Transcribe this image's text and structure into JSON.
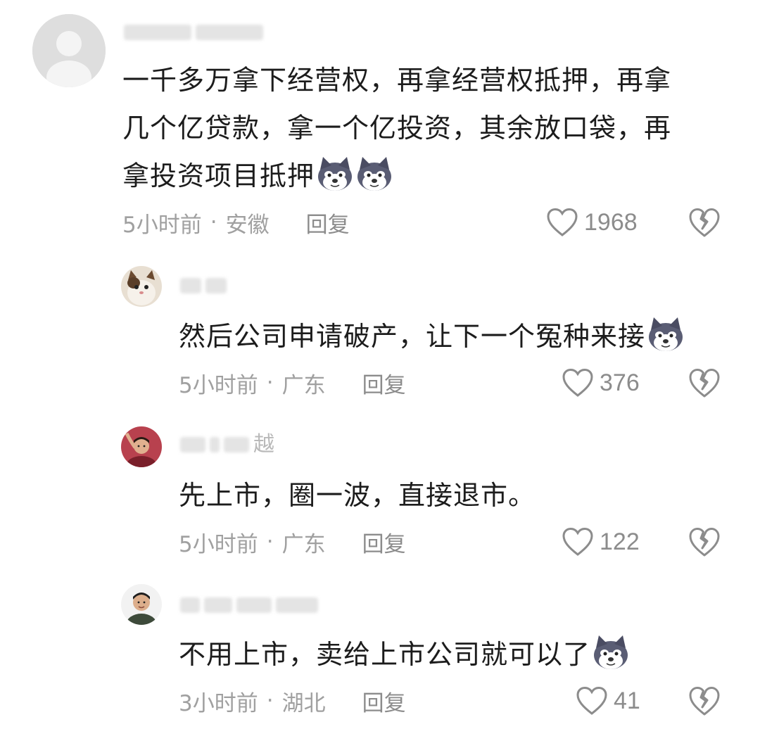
{
  "comments": [
    {
      "username_visible": "",
      "text": "一千多万拿下经营权，再拿经营权抵押，再拿几个亿贷款，拿一个亿投资，其余放口袋，再拿投资项目抵押",
      "lines": [
        "一千多万拿下经营权，再拿经营权抵押，再拿",
        "几个亿贷款，拿一个亿投资，其余放口袋，再",
        "拿投资项目抵押"
      ],
      "emoji_count": 2,
      "emoji_name": "husky-emoji",
      "time": "5小时前",
      "location": "安徽",
      "reply_label": "回复",
      "likes": "1968"
    },
    {
      "username_visible": "",
      "text": "然后公司申请破产，让下一个冤种来接",
      "lines": [
        "然后公司申请破产，让下一个冤种来接"
      ],
      "emoji_count": 1,
      "emoji_name": "husky-emoji",
      "time": "5小时前",
      "location": "广东",
      "reply_label": "回复",
      "likes": "376"
    },
    {
      "username_visible": "越",
      "text": "先上市，圈一波，直接退市。",
      "lines": [
        "先上市，圈一波，直接退市。"
      ],
      "emoji_count": 0,
      "time": "5小时前",
      "location": "广东",
      "reply_label": "回复",
      "likes": "122"
    },
    {
      "username_visible": "",
      "text": "不用上市，卖给上市公司就可以了",
      "lines": [
        "不用上市，卖给上市公司就可以了"
      ],
      "emoji_count": 1,
      "emoji_name": "husky-emoji",
      "time": "3小时前",
      "location": "湖北",
      "reply_label": "回复",
      "likes": "41"
    }
  ],
  "separator": "·",
  "icons": {
    "like": "heart-outline-icon",
    "dislike": "broken-heart-icon"
  },
  "colors": {
    "text": "#1c1c1c",
    "meta": "#a0a0a0",
    "icon": "#8c8c8c"
  }
}
